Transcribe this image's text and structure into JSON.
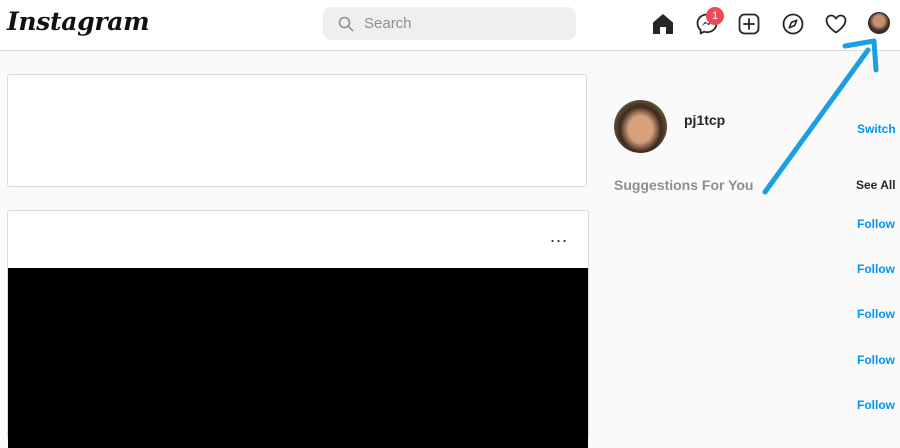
{
  "header": {
    "logo": "Instagram",
    "search_placeholder": "Search",
    "messages_badge": "1",
    "icons": [
      "home-icon",
      "messenger-icon",
      "new-post-icon",
      "explore-icon",
      "activity-heart-icon",
      "profile-avatar"
    ]
  },
  "sidebar": {
    "username": "pj1tcp",
    "switch_label": "Switch",
    "suggestions_title": "Suggestions For You",
    "see_all_label": "See All",
    "follow_labels": [
      "Follow",
      "Follow",
      "Follow",
      "Follow",
      "Follow"
    ]
  },
  "post": {
    "more_label": "..."
  },
  "colors": {
    "accent": "#0095f6",
    "badge": "#ed4956",
    "annotation_arrow": "#1aa0e0"
  }
}
